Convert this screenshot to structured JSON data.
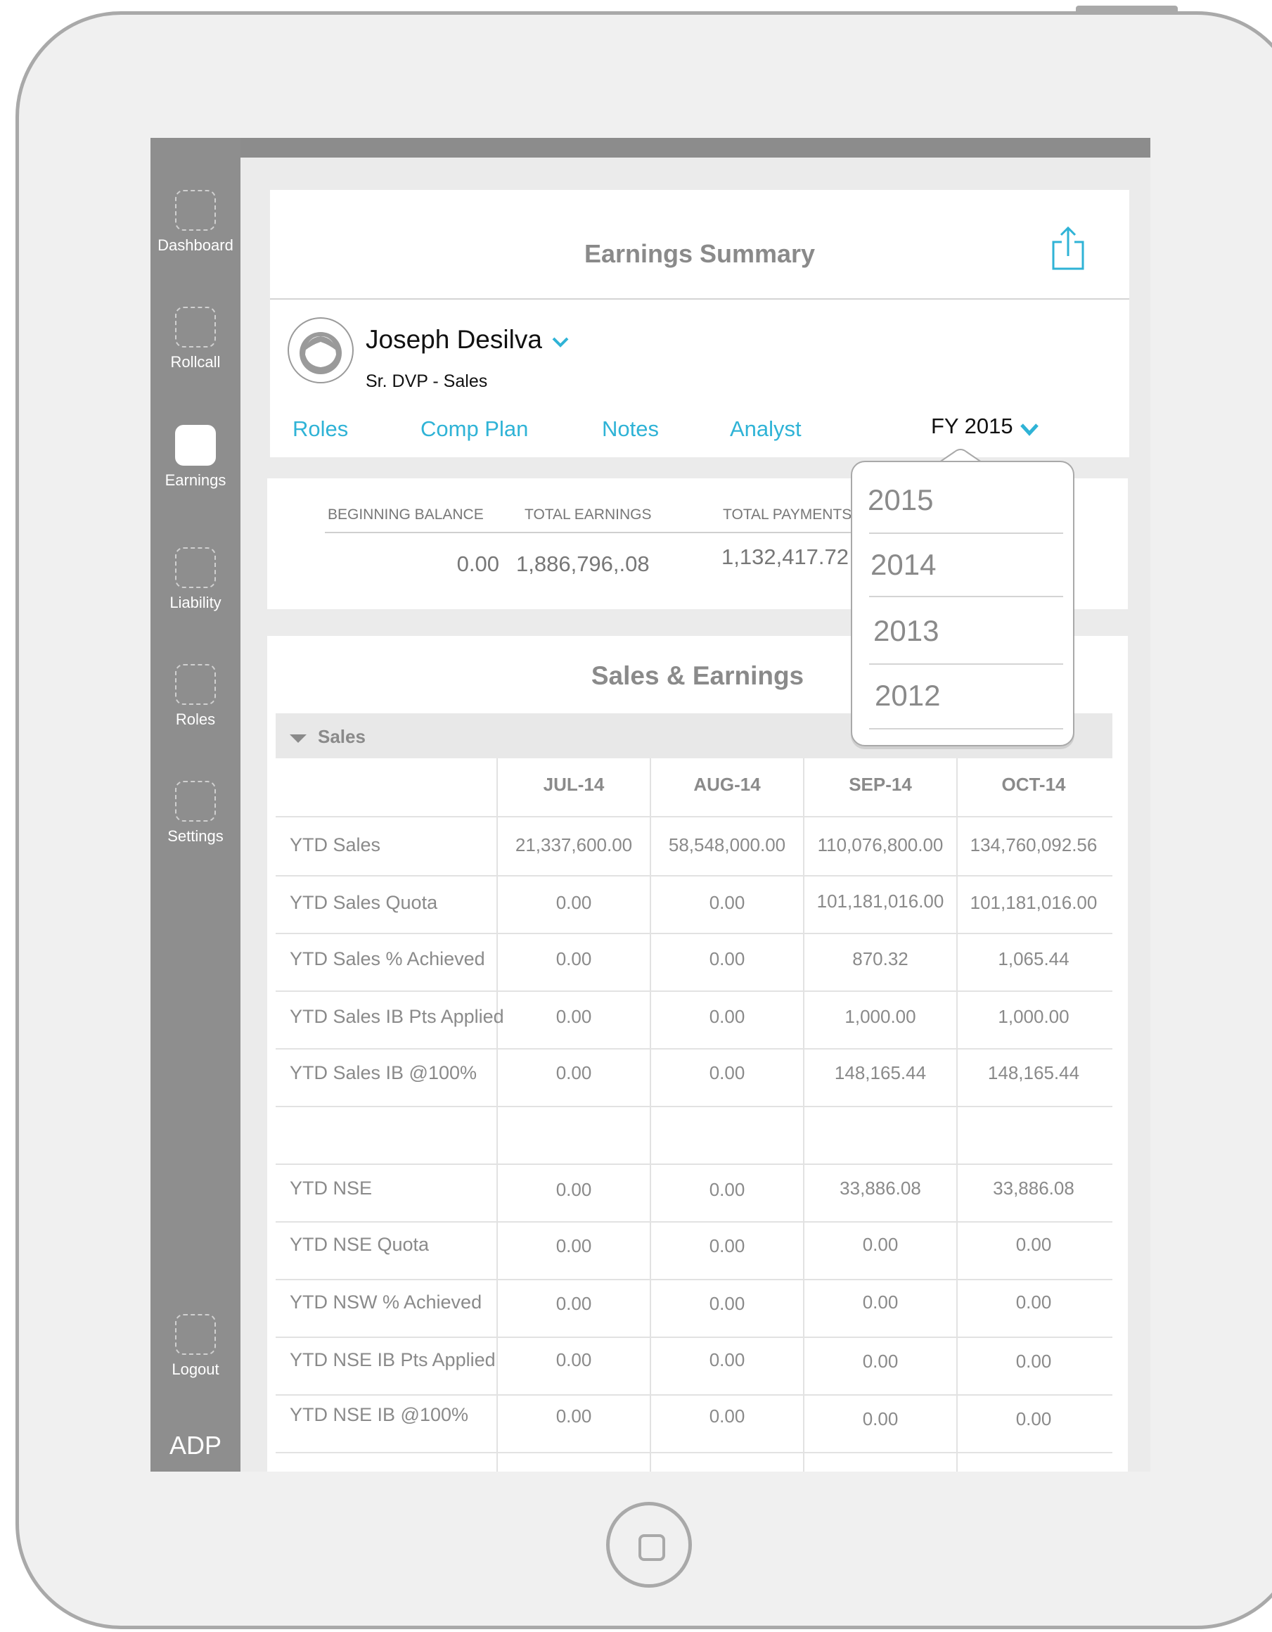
{
  "sidebar": {
    "items": [
      {
        "label": "Dashboard",
        "icon": "dashboard-icon",
        "active": false
      },
      {
        "label": "Rollcall",
        "icon": "rollcall-icon",
        "active": false
      },
      {
        "label": "Earnings",
        "icon": "earnings-icon",
        "active": true
      },
      {
        "label": "Liability",
        "icon": "liability-icon",
        "active": false
      },
      {
        "label": "Roles",
        "icon": "roles-icon",
        "active": false
      },
      {
        "label": "Settings",
        "icon": "settings-icon",
        "active": false
      }
    ],
    "logout_label": "Logout",
    "logo_text": "ADP"
  },
  "header": {
    "title": "Earnings Summary",
    "share_icon": "share-icon"
  },
  "user": {
    "name": "Joseph Desilva",
    "role": "Sr. DVP  - Sales"
  },
  "tabs": [
    "Roles",
    "Comp Plan",
    "Notes",
    "Analyst"
  ],
  "fiscal_year": {
    "selected": "FY 2015",
    "options": [
      "2015",
      "2014",
      "2013",
      "2012"
    ]
  },
  "balances": {
    "headers": [
      "BEGINNING BALANCE",
      "TOTAL EARNINGS",
      "TOTAL PAYMENTS"
    ],
    "values": [
      "0.00",
      "1,886,796,.08",
      "1,132,417.72"
    ]
  },
  "sales": {
    "title": "Sales & Earnings",
    "section_label": "Sales",
    "columns": [
      "JUL-14",
      "AUG-14",
      "SEP-14",
      "OCT-14"
    ],
    "rows": [
      {
        "label": "YTD Sales",
        "values": [
          "21,337,600.00",
          "58,548,000.00",
          "110,076,800.00",
          "134,760,092.56"
        ]
      },
      {
        "label": "YTD Sales Quota",
        "values": [
          "0.00",
          "0.00",
          "101,181,016.00",
          "101,181,016.00"
        ]
      },
      {
        "label": "YTD Sales % Achieved",
        "values": [
          "0.00",
          "0.00",
          "870.32",
          "1,065.44"
        ]
      },
      {
        "label": "YTD Sales IB Pts Applied",
        "values": [
          "0.00",
          "0.00",
          "1,000.00",
          "1,000.00"
        ]
      },
      {
        "label": "YTD Sales IB @100%",
        "values": [
          "0.00",
          "0.00",
          "148,165.44",
          "148,165.44"
        ]
      },
      {
        "label": "",
        "values": [
          "",
          "",
          "",
          ""
        ]
      },
      {
        "label": "YTD NSE",
        "values": [
          "0.00",
          "0.00",
          "33,886.08",
          "33,886.08"
        ]
      },
      {
        "label": "YTD NSE Quota",
        "values": [
          "0.00",
          "0.00",
          "0.00",
          "0.00"
        ]
      },
      {
        "label": "YTD NSW % Achieved",
        "values": [
          "0.00",
          "0.00",
          "0.00",
          "0.00"
        ]
      },
      {
        "label": "YTD NSE IB Pts Applied",
        "values": [
          "0.00",
          "0.00",
          "0.00",
          "0.00"
        ]
      },
      {
        "label": "YTD NSE IB @100%",
        "values": [
          "0.00",
          "0.00",
          "0.00",
          "0.00"
        ]
      }
    ]
  },
  "colors": {
    "accent": "#2fb3d6",
    "sidebar": "#8e8e8e",
    "text_muted": "#8a8a8a"
  }
}
